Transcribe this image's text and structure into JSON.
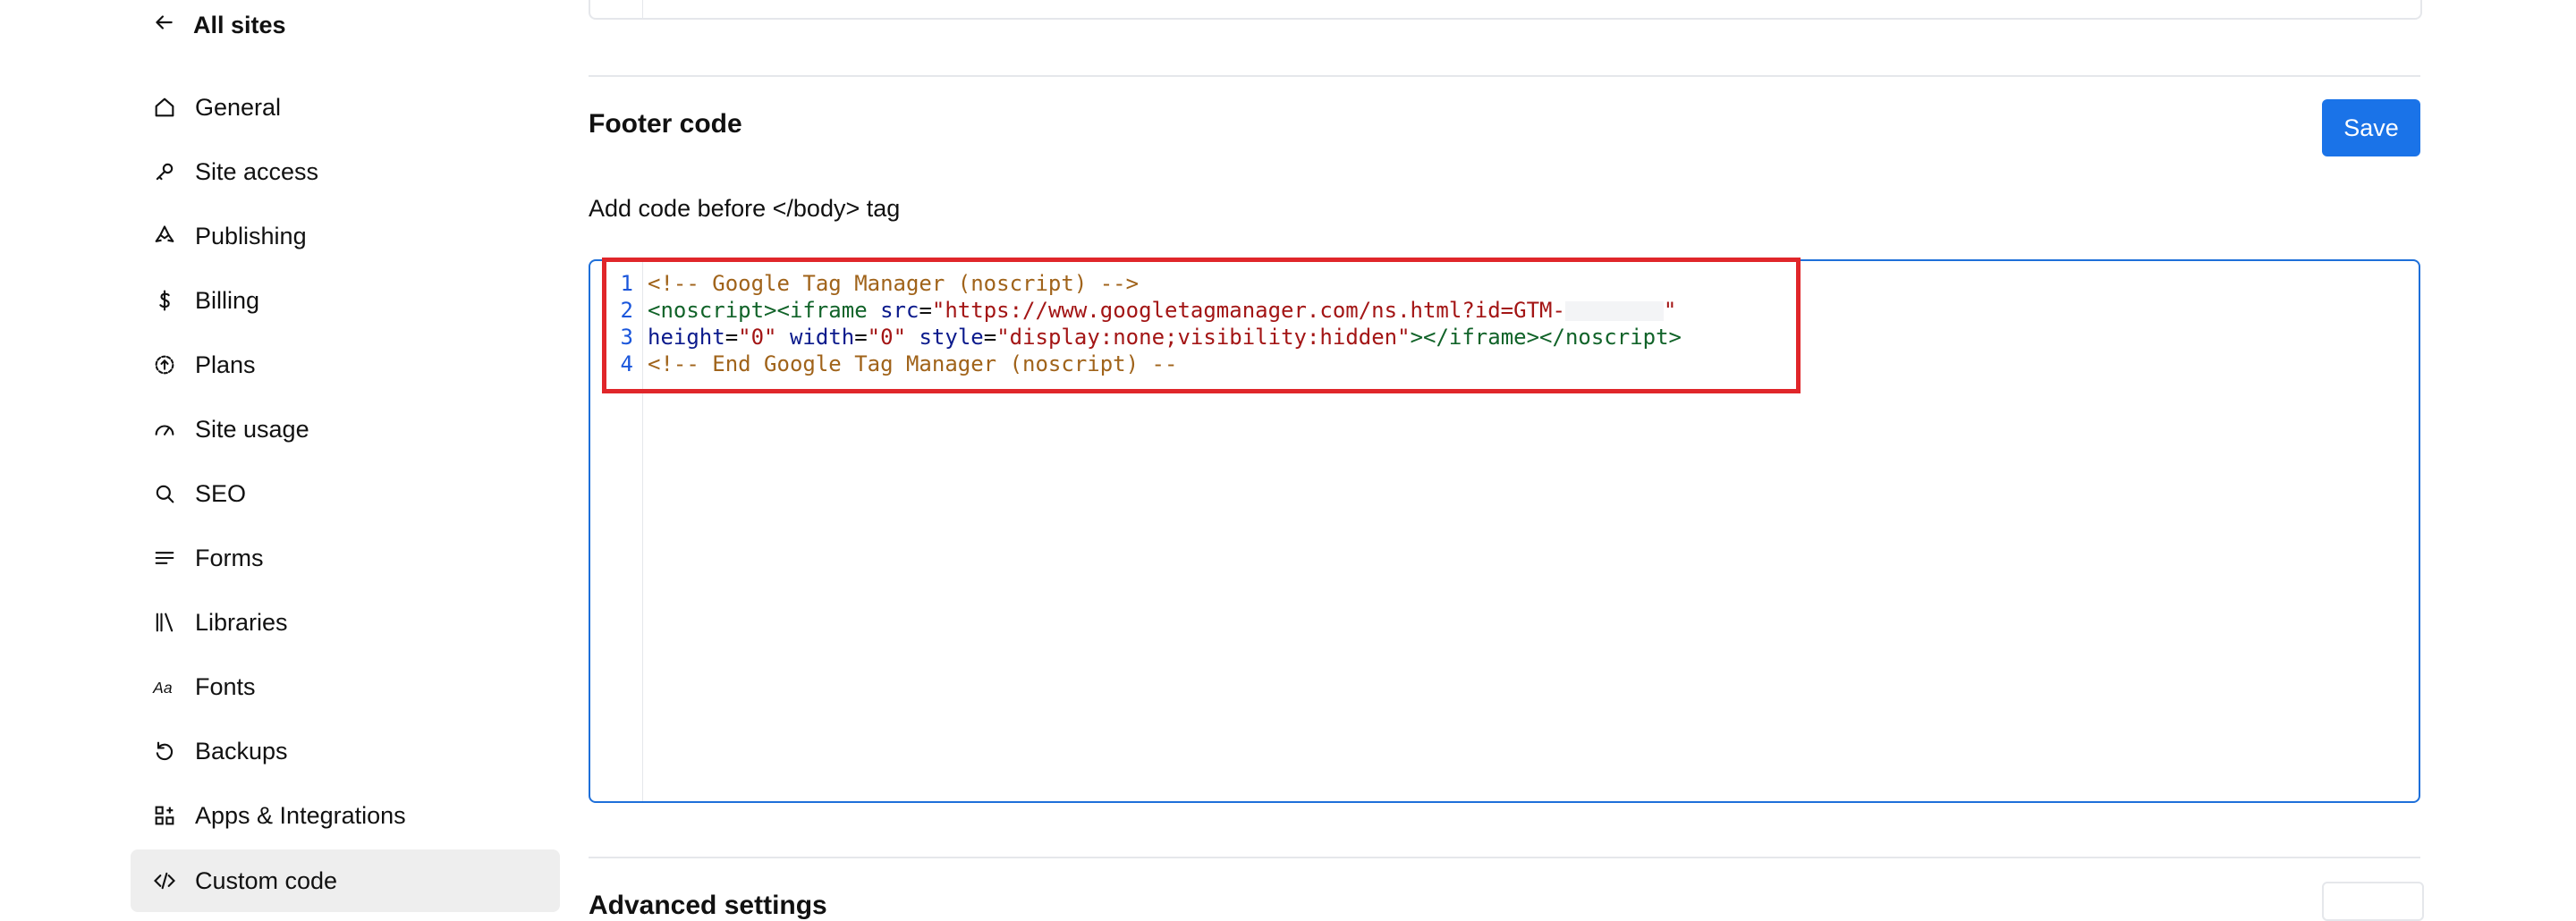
{
  "sidebar": {
    "back_label": "All sites",
    "items": [
      {
        "label": "General",
        "icon": "home-icon"
      },
      {
        "label": "Site access",
        "icon": "key-icon"
      },
      {
        "label": "Publishing",
        "icon": "rocket-icon"
      },
      {
        "label": "Billing",
        "icon": "dollar-icon"
      },
      {
        "label": "Plans",
        "icon": "plans-icon"
      },
      {
        "label": "Site usage",
        "icon": "gauge-icon"
      },
      {
        "label": "SEO",
        "icon": "search-icon"
      },
      {
        "label": "Forms",
        "icon": "lines-icon"
      },
      {
        "label": "Libraries",
        "icon": "library-icon"
      },
      {
        "label": "Fonts",
        "icon": "fonts-icon"
      },
      {
        "label": "Backups",
        "icon": "backup-icon"
      },
      {
        "label": "Apps & Integrations",
        "icon": "apps-icon"
      },
      {
        "label": "Custom code",
        "icon": "code-icon",
        "active": true
      }
    ]
  },
  "footer_code": {
    "title": "Footer code",
    "save_label": "Save",
    "description": "Add code before </body> tag",
    "lines": [
      {
        "num": "1",
        "text": "<!-- Google Tag Manager (noscript) -->"
      },
      {
        "num": "2",
        "text": "<noscript><iframe src=\"https://www.googletagmanager.com/ns.html?id=GTM-\""
      },
      {
        "num": "3",
        "text": "height=\"0\" width=\"0\" style=\"display:none;visibility:hidden\"></iframe></noscript>"
      },
      {
        "num": "4",
        "text": "<!-- End Google Tag Manager (noscript) --"
      }
    ],
    "code_parts": {
      "l1": "<!-- Google Tag Manager (noscript) -->",
      "l2_tag": "<noscript><iframe ",
      "l2_attr": "src",
      "l2_eq": "=",
      "l2_str": "\"https://www.googletagmanager.com/ns.html?id=GTM-",
      "l2_end": "\"",
      "l3_a1": "height",
      "l3_v1": "\"0\"",
      "l3_a2": "width",
      "l3_v2": "\"0\"",
      "l3_a3": "style",
      "l3_v3": "\"display:none;visibility:hidden\"",
      "l3_close": "></iframe></noscript>",
      "l4": "<!-- End Google Tag Manager (noscript) --"
    }
  },
  "advanced": {
    "title": "Advanced settings"
  },
  "colors": {
    "accent": "#1a73e8",
    "highlight": "#e0262a",
    "comment": "#a0631a",
    "tag": "#116329",
    "attr": "#0b1a8c",
    "string": "#a31515"
  }
}
